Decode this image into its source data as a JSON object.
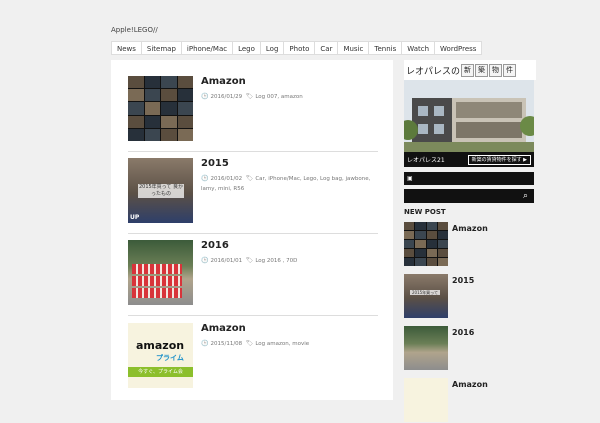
{
  "site": {
    "title": "Apple!LEGO//"
  },
  "nav": [
    "News",
    "Sitemap",
    "iPhone/Mac",
    "Lego",
    "Log",
    "Photo",
    "Car",
    "Music",
    "Tennis",
    "Watch",
    "WordPress"
  ],
  "posts": [
    {
      "title": "Amazon",
      "date": "2016/01/29",
      "tags": "Log 007, amazon"
    },
    {
      "title": "2015",
      "date": "2016/01/02",
      "tags": "Car, iPhone/Mac, Lego, Log bag, jawbone, lamy, mini, R56",
      "thumb_caption": "2015年買って 良かったもの",
      "thumb_badge": "UP"
    },
    {
      "title": "2016",
      "date": "2016/01/01",
      "tags": "Log 2016 , 70D"
    },
    {
      "title": "Amazon",
      "date": "2015/11/08",
      "tags": "Log amazon, movie",
      "thumb_logo": "amazon",
      "thumb_logo2": "プライム",
      "thumb_strip": "今すぐ、プライム会"
    }
  ],
  "sidebar": {
    "ad": {
      "title": "レオパレスの",
      "boxes": [
        "新",
        "築",
        "物",
        "件"
      ],
      "brand": "レオパレス21",
      "button": "新築の賃貸物件を探す ▶"
    },
    "rss_icon": "rss-icon",
    "search_icon": "search-icon",
    "new_post_heading": "NEW POST",
    "new_posts": [
      {
        "title": "Amazon"
      },
      {
        "title": "2015",
        "thumb_caption": "2015年買って"
      },
      {
        "title": "2016"
      },
      {
        "title": "Amazon"
      }
    ]
  },
  "colors": {
    "background": "#f0f0f0",
    "bar": "#111111",
    "accent_green": "#8cbf2c"
  }
}
